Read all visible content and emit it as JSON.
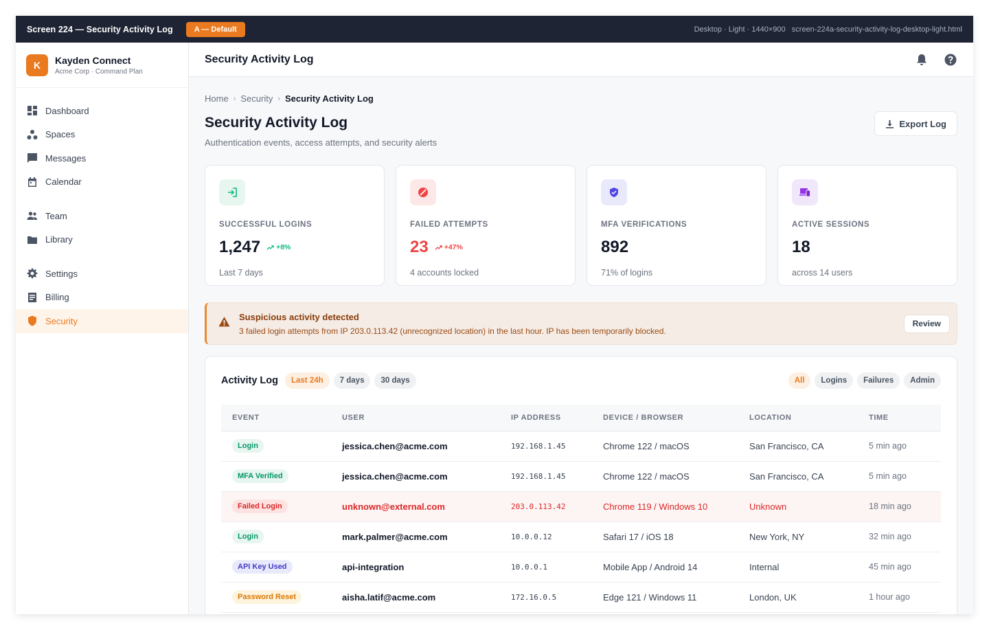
{
  "topbar": {
    "title": "Screen 224 — Security Activity Log",
    "variant": "A — Default",
    "meta": "Desktop · Light · 1440×900   screen-224a-security-activity-log-desktop-light.html"
  },
  "brand": {
    "initial": "K",
    "name": "Kayden Connect",
    "plan": "Acme Corp · Command Plan"
  },
  "sidebar": {
    "items": [
      {
        "label": "Dashboard",
        "icon": "dashboard-icon"
      },
      {
        "label": "Spaces",
        "icon": "spaces-icon"
      },
      {
        "label": "Messages",
        "icon": "messages-icon"
      },
      {
        "label": "Calendar",
        "icon": "calendar-icon"
      },
      {
        "label": "Team",
        "icon": "team-icon"
      },
      {
        "label": "Library",
        "icon": "folder-icon"
      },
      {
        "label": "Settings",
        "icon": "gear-icon"
      },
      {
        "label": "Billing",
        "icon": "billing-icon"
      },
      {
        "label": "Security",
        "icon": "shield-icon",
        "active": true
      }
    ]
  },
  "header": {
    "title": "Security Activity Log",
    "icons": [
      "bell-icon",
      "help-icon"
    ]
  },
  "breadcrumb": [
    "Home",
    "Security",
    "Security Activity Log"
  ],
  "page": {
    "title": "Security Activity Log",
    "subtitle": "Authentication events, access attempts, and security alerts",
    "export_label": "Export Log"
  },
  "stats": [
    {
      "label": "SUCCESSFUL LOGINS",
      "value": "1,247",
      "trend": "+8%",
      "foot": "Last 7 days",
      "icon": "login-icon",
      "color": "#10b981",
      "bg": "#e7f6ef"
    },
    {
      "label": "FAILED ATTEMPTS",
      "value": "23",
      "trend": "+47%",
      "foot": "4 accounts locked",
      "icon": "block-icon",
      "color": "#ef4444",
      "bg": "#fde8e8"
    },
    {
      "label": "MFA VERIFICATIONS",
      "value": "892",
      "trend": "",
      "foot": "71% of logins",
      "icon": "shield-check-icon",
      "color": "#4f46e5",
      "bg": "#e8eafc"
    },
    {
      "label": "ACTIVE SESSIONS",
      "value": "18",
      "trend": "",
      "foot": "across 14 users",
      "icon": "devices-icon",
      "color": "#9333ea",
      "bg": "#f1e7fb"
    }
  ],
  "alert": {
    "title": "Suspicious activity detected",
    "body": "3 failed login attempts from IP 203.0.113.42 (unrecognized location) in the last hour. IP has been temporarily blocked.",
    "action": "Review"
  },
  "activity": {
    "title": "Activity Log",
    "ranges": [
      "Last 24h",
      "7 days",
      "30 days"
    ],
    "filters": [
      "All",
      "Logins",
      "Failures",
      "Admin"
    ],
    "columns": [
      "EVENT",
      "USER",
      "IP ADDRESS",
      "DEVICE / BROWSER",
      "LOCATION",
      "TIME"
    ],
    "rows": [
      {
        "event": "Login",
        "user": "jessica.chen@acme.com",
        "ip": "192.168.1.45",
        "device": "Chrome 122 / macOS",
        "location": "San Francisco, CA",
        "time": "5 min ago"
      },
      {
        "event": "MFA Verified",
        "user": "jessica.chen@acme.com",
        "ip": "192.168.1.45",
        "device": "Chrome 122 / macOS",
        "location": "San Francisco, CA",
        "time": "5 min ago"
      },
      {
        "event": "Failed Login",
        "user": "unknown@external.com",
        "ip": "203.0.113.42",
        "device": "Chrome 119 / Windows 10",
        "location": "Unknown",
        "time": "18 min ago"
      },
      {
        "event": "Login",
        "user": "mark.palmer@acme.com",
        "ip": "10.0.0.12",
        "device": "Safari 17 / iOS 18",
        "location": "New York, NY",
        "time": "32 min ago"
      },
      {
        "event": "API Key Used",
        "user": "api-integration",
        "ip": "10.0.0.1",
        "device": "Mobile App / Android 14",
        "location": "Internal",
        "time": "45 min ago"
      },
      {
        "event": "Password Reset",
        "user": "aisha.latif@acme.com",
        "ip": "172.16.0.5",
        "device": "Edge 121 / Windows 11",
        "location": "London, UK",
        "time": "1 hour ago"
      }
    ]
  },
  "colors": {
    "accent": "#ea7a1f",
    "success": "#10b981",
    "danger": "#dc2626",
    "info": "#4f46e5",
    "warning": "#f59e0b"
  }
}
